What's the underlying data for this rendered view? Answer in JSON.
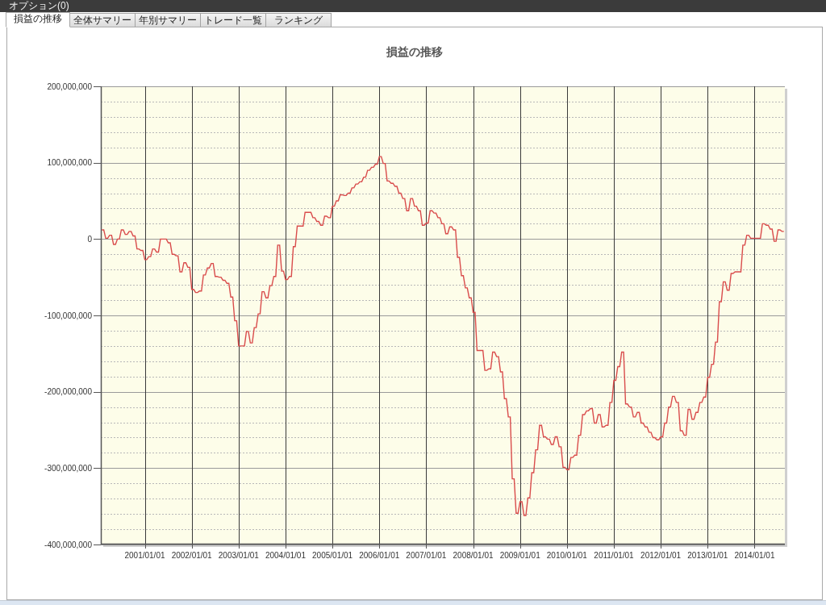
{
  "menu_bar": {
    "title": "オプション(0)"
  },
  "tabs": [
    {
      "label": "損益の推移",
      "selected": true
    },
    {
      "label": "全体サマリー",
      "selected": false
    },
    {
      "label": "年別サマリー",
      "selected": false
    },
    {
      "label": "トレード一覧",
      "selected": false
    },
    {
      "label": "ランキング",
      "selected": false
    }
  ],
  "chart": {
    "chart_data": {
      "type": "line",
      "title": "損益の推移",
      "grid": true,
      "categories": [
        null,
        null,
        null,
        null,
        null,
        null,
        null,
        null,
        null,
        null,
        null,
        null,
        null,
        null,
        null,
        null,
        null,
        null,
        null,
        null,
        null,
        null,
        "2001/01/01",
        null,
        null,
        null,
        null,
        null,
        null,
        null,
        null,
        null,
        null,
        null,
        null,
        null,
        null,
        null,
        null,
        null,
        null,
        null,
        null,
        null,
        null,
        null,
        "2002/01/01",
        null,
        null,
        null,
        null,
        null,
        null,
        null,
        null,
        null,
        null,
        null,
        null,
        null,
        null,
        null,
        null,
        null,
        null,
        null,
        null,
        null,
        null,
        null,
        "2003/01/01",
        null,
        null,
        null,
        null,
        null,
        null,
        null,
        null,
        null,
        null,
        null,
        null,
        null,
        null,
        null,
        null,
        null,
        null,
        null,
        null,
        null,
        null,
        null,
        "2004/01/01",
        null,
        null,
        null,
        null,
        null,
        null,
        null,
        null,
        null,
        null,
        null,
        null,
        null,
        null,
        null,
        null,
        null,
        null,
        null,
        null,
        null,
        null,
        null,
        "2005/01/01",
        null,
        null,
        null,
        null,
        null,
        null,
        null,
        null,
        null,
        null,
        null,
        null,
        null,
        null,
        null,
        null,
        null,
        null,
        null,
        null,
        null,
        null,
        null,
        "2006/01/01",
        null,
        null,
        null,
        null,
        null,
        null,
        null,
        null,
        null,
        null,
        null,
        null,
        null,
        null,
        null,
        null,
        null,
        null,
        null,
        null,
        null,
        null,
        null,
        "2007/01/01",
        null,
        null,
        null,
        null,
        null,
        null,
        null,
        null,
        null,
        null,
        null,
        null,
        null,
        null,
        null,
        null,
        null,
        null,
        null,
        null,
        null,
        null,
        null,
        "2008/01/01",
        null,
        null,
        null,
        null,
        null,
        null,
        null,
        null,
        null,
        null,
        null,
        null,
        null,
        null,
        null,
        null,
        null,
        null,
        null,
        null,
        null,
        null,
        null,
        "2009/01/01",
        null,
        null,
        null,
        null,
        null,
        null,
        null,
        null,
        null,
        null,
        null,
        null,
        null,
        null,
        null,
        null,
        null,
        null,
        null,
        null,
        null,
        null,
        null,
        "2010/01/01",
        null,
        null,
        null,
        null,
        null,
        null,
        null,
        null,
        null,
        null,
        null,
        null,
        null,
        null,
        null,
        null,
        null,
        null,
        null,
        null,
        null,
        null,
        null,
        "2011/01/01",
        null,
        null,
        null,
        null,
        null,
        null,
        null,
        null,
        null,
        null,
        null,
        null,
        null,
        null,
        null,
        null,
        null,
        null,
        null,
        null,
        null,
        null,
        null,
        "2012/01/01",
        null,
        null,
        null,
        null,
        null,
        null,
        null,
        null,
        null,
        null,
        null,
        null,
        null,
        null,
        null,
        null,
        null,
        null,
        null,
        null,
        null,
        null,
        null,
        "2013/01/01",
        null,
        null,
        null,
        null,
        null,
        null,
        null,
        null,
        null,
        null,
        null,
        null,
        null,
        null,
        null,
        null,
        null,
        null,
        null,
        null,
        null,
        null,
        null,
        "2014/01/01",
        null,
        null,
        null,
        null,
        null,
        null,
        null,
        null,
        null,
        null,
        null,
        null,
        null,
        null,
        null
      ],
      "series": [
        {
          "color": "#d94c4c",
          "values": [
            12000000,
            12000000,
            1000000,
            1000000,
            5000000,
            5000000,
            -7000000,
            -7000000,
            0,
            0,
            12000000,
            12000000,
            6000000,
            6000000,
            10000000,
            10000000,
            4000000,
            4000000,
            -13000000,
            -13000000,
            -15000000,
            -15000000,
            -27000000,
            -27000000,
            -23000000,
            -23000000,
            -13000000,
            -13000000,
            -17000000,
            -17000000,
            0,
            0,
            0,
            0,
            -5000000,
            -5000000,
            -20000000,
            -20000000,
            -22000000,
            -22000000,
            -43000000,
            -43000000,
            -31000000,
            -31000000,
            -37000000,
            -37000000,
            -66000000,
            -66000000,
            -70000000,
            -70000000,
            -68000000,
            -68000000,
            -47000000,
            -47000000,
            -38000000,
            -38000000,
            -32000000,
            -32000000,
            -49000000,
            -49000000,
            -50000000,
            -50000000,
            -54000000,
            -54000000,
            -58000000,
            -58000000,
            -76000000,
            -76000000,
            -107000000,
            -107000000,
            -140000000,
            -140000000,
            -140000000,
            -140000000,
            -121000000,
            -121000000,
            -136000000,
            -136000000,
            -116000000,
            -116000000,
            -98000000,
            -98000000,
            -69000000,
            -69000000,
            -77000000,
            -77000000,
            -61000000,
            -61000000,
            -49000000,
            -49000000,
            -8000000,
            -8000000,
            -42000000,
            -42000000,
            -53000000,
            -53000000,
            -49000000,
            -49000000,
            -10000000,
            -10000000,
            17000000,
            17000000,
            17000000,
            17000000,
            35000000,
            35000000,
            35000000,
            35000000,
            28000000,
            28000000,
            23000000,
            23000000,
            18000000,
            18000000,
            30000000,
            30000000,
            28000000,
            28000000,
            43000000,
            43000000,
            50000000,
            50000000,
            58000000,
            58000000,
            57000000,
            57000000,
            60000000,
            60000000,
            67000000,
            67000000,
            72000000,
            72000000,
            75000000,
            75000000,
            81000000,
            81000000,
            90000000,
            90000000,
            94000000,
            94000000,
            98000000,
            98000000,
            108000000,
            108000000,
            99000000,
            99000000,
            76000000,
            76000000,
            73000000,
            73000000,
            69000000,
            69000000,
            60000000,
            60000000,
            53000000,
            53000000,
            37000000,
            37000000,
            53000000,
            53000000,
            43000000,
            43000000,
            37000000,
            37000000,
            18000000,
            18000000,
            21000000,
            21000000,
            37000000,
            37000000,
            34000000,
            34000000,
            28000000,
            28000000,
            20000000,
            20000000,
            7000000,
            7000000,
            16000000,
            16000000,
            12000000,
            12000000,
            -24000000,
            -24000000,
            -48000000,
            -48000000,
            -64000000,
            -64000000,
            -77000000,
            -77000000,
            -96000000,
            -96000000,
            -146000000,
            -146000000,
            -146000000,
            -146000000,
            -172000000,
            -172000000,
            -170000000,
            -170000000,
            -148000000,
            -148000000,
            -154000000,
            -154000000,
            -174000000,
            -174000000,
            -209000000,
            -209000000,
            -233000000,
            -233000000,
            -314000000,
            -314000000,
            -359000000,
            -359000000,
            -344000000,
            -344000000,
            -362000000,
            -362000000,
            -339000000,
            -339000000,
            -306000000,
            -306000000,
            -276000000,
            -276000000,
            -244000000,
            -244000000,
            -259000000,
            -259000000,
            -262000000,
            -262000000,
            -269000000,
            -269000000,
            -259000000,
            -259000000,
            -272000000,
            -272000000,
            -299000000,
            -299000000,
            -302000000,
            -302000000,
            -286000000,
            -286000000,
            -283000000,
            -283000000,
            -257000000,
            -257000000,
            -230000000,
            -230000000,
            -225000000,
            -225000000,
            -222000000,
            -222000000,
            -241000000,
            -241000000,
            -230000000,
            -230000000,
            -246000000,
            -246000000,
            -244000000,
            -244000000,
            -214000000,
            -214000000,
            -185000000,
            -185000000,
            -167000000,
            -167000000,
            -148000000,
            -148000000,
            -216000000,
            -216000000,
            -220000000,
            -220000000,
            -233000000,
            -233000000,
            -227000000,
            -227000000,
            -241000000,
            -241000000,
            -246000000,
            -246000000,
            -253000000,
            -253000000,
            -260000000,
            -260000000,
            -263000000,
            -263000000,
            -259000000,
            -259000000,
            -241000000,
            -241000000,
            -220000000,
            -220000000,
            -206000000,
            -206000000,
            -214000000,
            -214000000,
            -251000000,
            -251000000,
            -257000000,
            -257000000,
            -223000000,
            -223000000,
            -236000000,
            -236000000,
            -227000000,
            -227000000,
            -214000000,
            -214000000,
            -207000000,
            -207000000,
            -181000000,
            -181000000,
            -164000000,
            -164000000,
            -135000000,
            -135000000,
            -82000000,
            -82000000,
            -56000000,
            -56000000,
            -67000000,
            -67000000,
            -45000000,
            -45000000,
            -43000000,
            -43000000,
            -43000000,
            -43000000,
            -8000000,
            -8000000,
            5000000,
            5000000,
            1000000,
            1000000,
            1000000,
            1000000,
            1000000,
            1000000,
            20000000,
            20000000,
            18000000,
            18000000,
            13000000,
            13000000,
            -3000000,
            -3000000,
            12000000,
            12000000,
            10000000,
            10000000
          ]
        }
      ],
      "ylim": [
        -400000000,
        200000000
      ],
      "yticks": [
        {
          "value": 200000000,
          "label": "200,000,000"
        },
        {
          "value": 100000000,
          "label": "100,000,000"
        },
        {
          "value": 0,
          "label": "0"
        },
        {
          "value": -100000000,
          "label": "-100,000,000"
        },
        {
          "value": -200000000,
          "label": "-200,000,000"
        },
        {
          "value": -300000000,
          "label": "-300,000,000"
        },
        {
          "value": -400000000,
          "label": "-400,000,000"
        }
      ]
    }
  }
}
